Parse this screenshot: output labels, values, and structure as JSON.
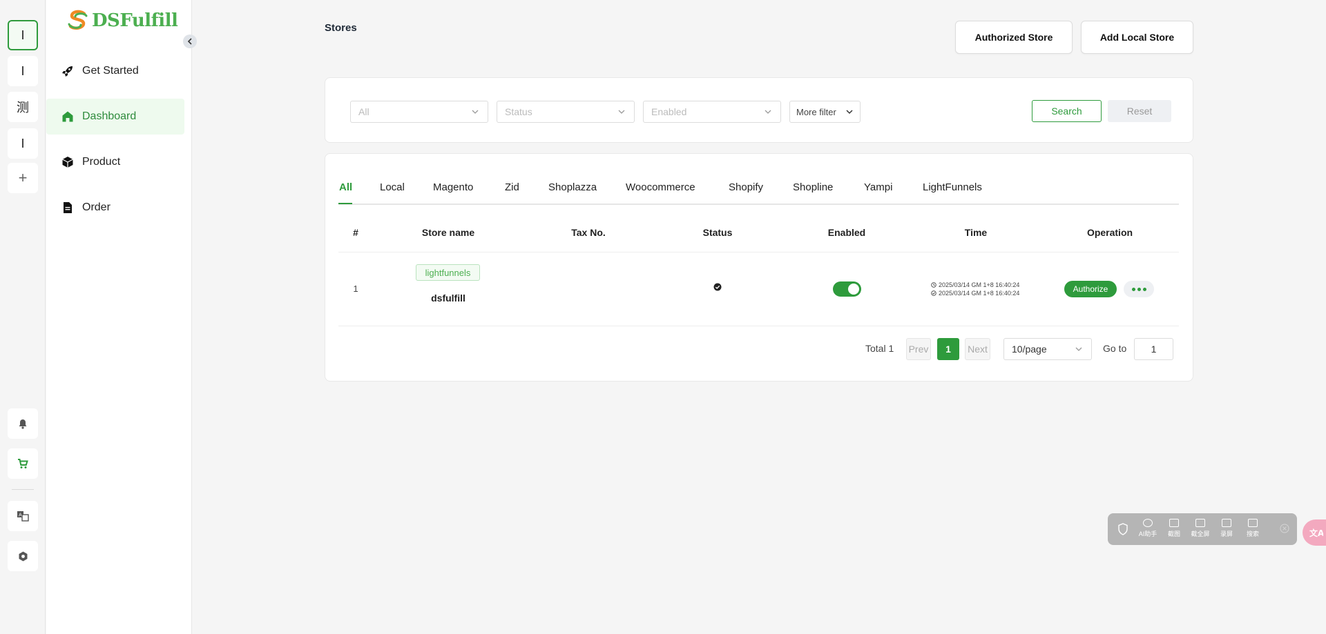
{
  "rail": {
    "items": [
      "I",
      "I",
      "测",
      "I"
    ],
    "add_label": "+"
  },
  "sidebar": {
    "logo_text": "DSFulfill",
    "nav": [
      {
        "label": "Get Started",
        "icon": "rocket-icon"
      },
      {
        "label": "Dashboard",
        "icon": "home-icon",
        "active": true
      },
      {
        "label": "Product",
        "icon": "box-icon"
      },
      {
        "label": "Order",
        "icon": "document-icon"
      }
    ]
  },
  "header": {
    "title": "Stores",
    "authorized_store_label": "Authorized Store",
    "add_local_store_label": "Add Local Store"
  },
  "filters": {
    "platform_placeholder": "All",
    "status_placeholder": "Status",
    "enabled_placeholder": "Enabled",
    "more_filter_label": "More filter",
    "search_label": "Search",
    "reset_label": "Reset"
  },
  "tabs": [
    "All",
    "Local",
    "Magento",
    "Zid",
    "Shoplazza",
    "Woocommerce",
    "Shopify",
    "Shopline",
    "Yampi",
    "LightFunnels"
  ],
  "table": {
    "columns": [
      "#",
      "Store name",
      "Tax No.",
      "Status",
      "Enabled",
      "Time",
      "Operation"
    ],
    "rows": [
      {
        "index": "1",
        "platform_tag": "lightfunnels",
        "store_name": "dsfulfill",
        "tax_no": "",
        "enabled": true,
        "time_created": "2025/03/14 GM 1+8 16:40:24",
        "time_updated": "2025/03/14 GM 1+8 16:40:24",
        "authorize_label": "Authorize"
      }
    ]
  },
  "pagination": {
    "total_label": "Total 1",
    "prev_label": "Prev",
    "current_page": "1",
    "next_label": "Next",
    "page_size": "10/page",
    "goto_label": "Go to",
    "goto_value": "1"
  },
  "floatbar": {
    "items": [
      "AI助手",
      "截图",
      "截全屏",
      "录屏",
      "搜索"
    ]
  },
  "colors": {
    "brand_green": "#2e9b3c",
    "logo_orange": "#f08a24",
    "logo_green": "#4caf50"
  }
}
